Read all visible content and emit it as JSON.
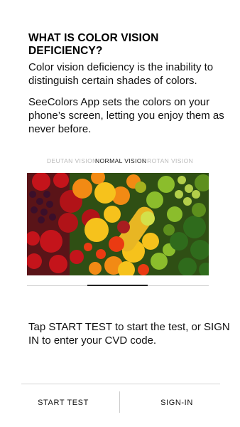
{
  "title": "WHAT IS COLOR VISION DEFICIENCY?",
  "paragraph1": "Color vision deficiency is the inability to distinguish certain shades of colors.",
  "paragraph2": "SeeColors App sets the colors on your phone’s screen, letting you enjoy them as never before.",
  "vision_tabs": [
    {
      "label": "DEUTAN VISION",
      "selected": false
    },
    {
      "label": "NORMAL VISION",
      "selected": true
    },
    {
      "label": "PROTAN VISION",
      "selected": false
    }
  ],
  "image_alt": "vegetables-and-fruits-photo",
  "page_indicator": {
    "pages": 3,
    "current": 2
  },
  "instruction": "Tap START TEST to start the test, or SIGN IN to enter your CVD code.",
  "buttons": {
    "start_test": "START TEST",
    "sign_in": "SIGN-IN"
  }
}
